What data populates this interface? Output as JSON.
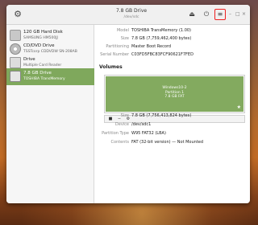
{
  "window": {
    "title": "7.8 GB Drive",
    "subtitle": "/dev/sdc"
  },
  "toolbar": {
    "gear_icon": "gear-icon",
    "eject_icon": "eject-icon",
    "power_icon": "power-icon",
    "menu_icon": "hamburger-menu-icon",
    "window_controls": [
      "–",
      "□",
      "×"
    ],
    "highlight_color": "#e22222"
  },
  "sidebar": {
    "devices": [
      {
        "name": "120 GB Hard Disk",
        "detail": "SAMSUNG HM500JJ",
        "icon": "hdd-icon",
        "selected": false
      },
      {
        "name": "CD/DVD Drive",
        "detail": "TSSTcorp CDDVDW SN-208AB",
        "icon": "optical-drive-icon",
        "selected": false
      },
      {
        "name": "Drive",
        "detail": "Multiple Card Reader",
        "icon": "card-reader-icon",
        "selected": false
      },
      {
        "name": "7.8 GB Drive",
        "detail": "TOSHIBA TransMemory",
        "icon": "usb-drive-icon",
        "selected": true
      }
    ],
    "selected_color": "#7fa85c"
  },
  "drive_info": [
    {
      "key": "Model",
      "value": "TOSHIBA TransMemory (1.00)"
    },
    {
      "key": "Size",
      "value": "7.8 GB (7,759,462,400 bytes)"
    },
    {
      "key": "Partitioning",
      "value": "Master Boot Record"
    },
    {
      "key": "Serial Number",
      "value": "C03FD5FBC83FCF90621F7FED"
    }
  ],
  "volumes": {
    "heading": "Volumes",
    "partition": {
      "lines": [
        "Windows10-2",
        "Partition 1",
        "7.8 GB FAT"
      ],
      "color": "#83aa5f"
    },
    "toolbar": {
      "stop_icon": "stop-icon",
      "minus_icon": "minus-icon",
      "settings_icon": "gears-icon"
    }
  },
  "volume_info": [
    {
      "key": "Size",
      "value": "7.8 GB (7,756,413,824 bytes)"
    },
    {
      "key": "Device",
      "value": "/dev/sdc1"
    },
    {
      "key": "Partition Type",
      "value": "W95 FAT32 (LBA)"
    },
    {
      "key": "Contents",
      "value": "FAT (32-bit version) — Not Mounted"
    }
  ]
}
